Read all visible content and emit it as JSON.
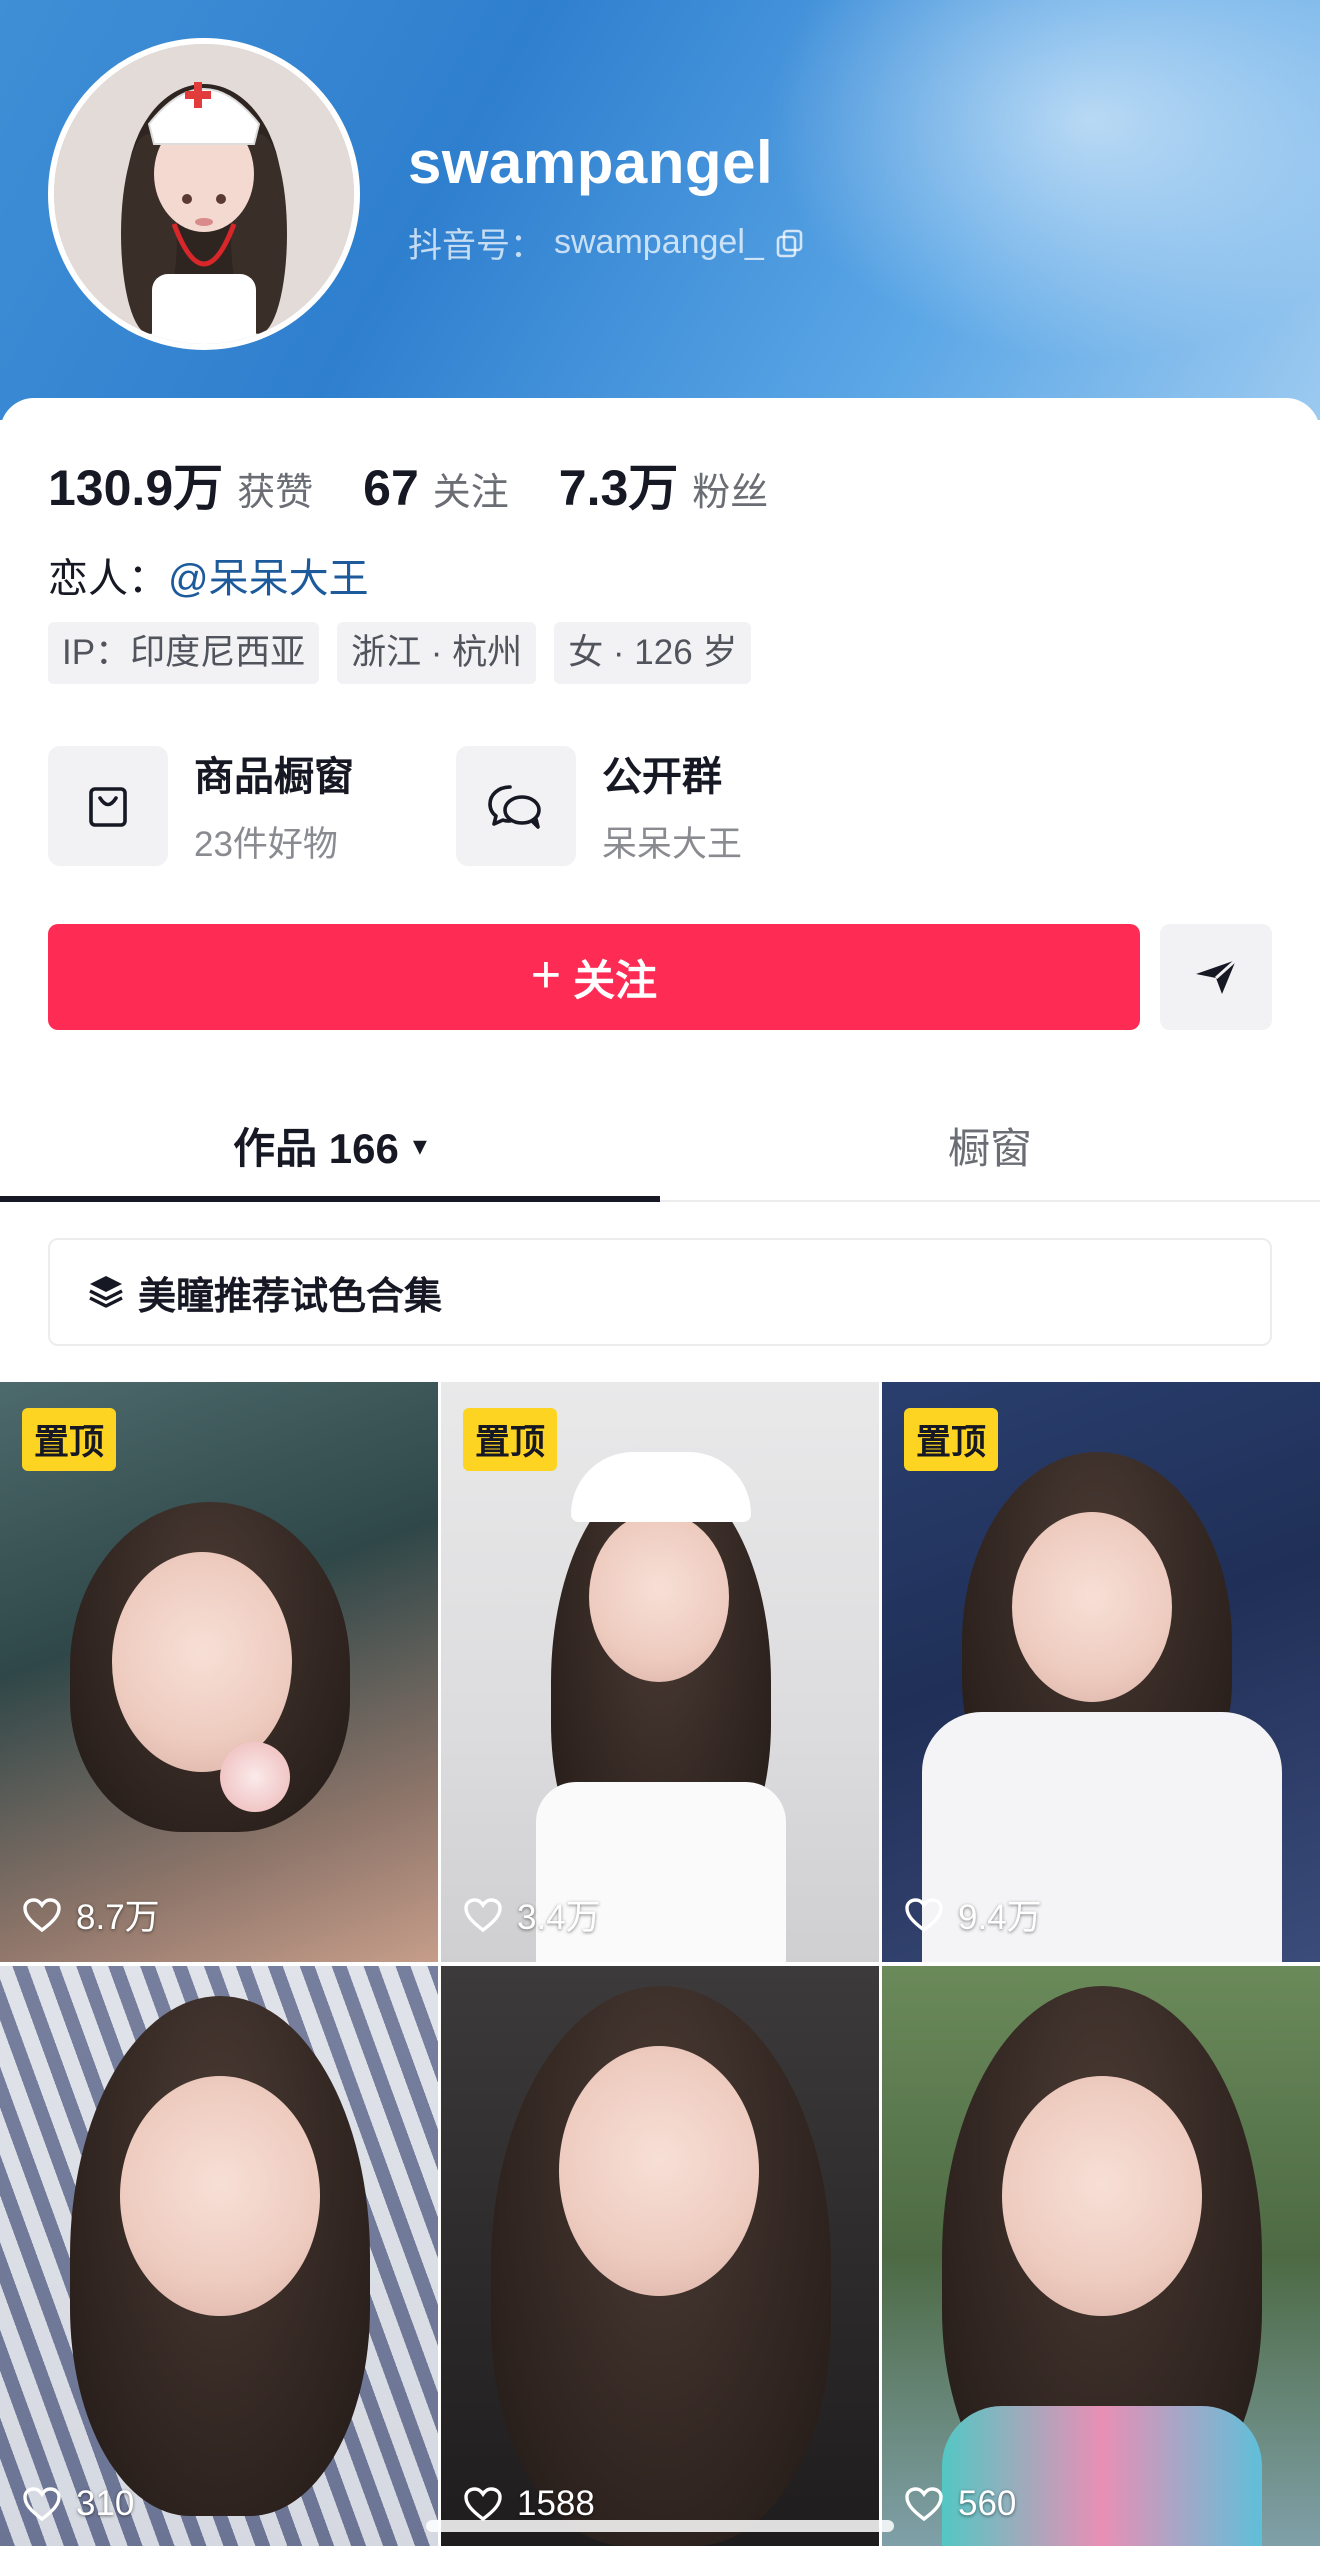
{
  "profile": {
    "username": "swampangel",
    "douyin_id_label": "抖音号：",
    "douyin_id": "swampangel_"
  },
  "stats": [
    {
      "value": "130.9万",
      "label": "获赞"
    },
    {
      "value": "67",
      "label": "关注"
    },
    {
      "value": "7.3万",
      "label": "粉丝"
    }
  ],
  "lover": {
    "label": "恋人：",
    "name": "@呆呆大王"
  },
  "tags": [
    "IP：印度尼西亚",
    "浙江 · 杭州",
    "女 · 126 岁"
  ],
  "features": [
    {
      "title": "商品橱窗",
      "subtitle": "23件好物",
      "icon": "shopping-bag-icon"
    },
    {
      "title": "公开群",
      "subtitle": "呆呆大王",
      "icon": "group-chat-icon"
    }
  ],
  "actions": {
    "follow_label": "关注",
    "follow_icon": "+",
    "share_icon": "send-icon"
  },
  "tabs": {
    "works_label": "作品 166",
    "works_caret": "▾",
    "shop_label": "橱窗"
  },
  "collection": {
    "label": "美瞳推荐试色合集",
    "icon": "layers-icon"
  },
  "videos": [
    {
      "pinned": "置顶",
      "likes": "8.7万"
    },
    {
      "pinned": "置顶",
      "likes": "3.4万"
    },
    {
      "pinned": "置顶",
      "likes": "9.4万"
    },
    {
      "pinned": "",
      "likes": "310"
    },
    {
      "pinned": "",
      "likes": "1588"
    },
    {
      "pinned": "",
      "likes": "560"
    }
  ],
  "colors": {
    "accent": "#fe2c55",
    "pin_badge": "#fdd422",
    "link": "#1d5a9c",
    "header_blue": "#2f7fcf"
  }
}
